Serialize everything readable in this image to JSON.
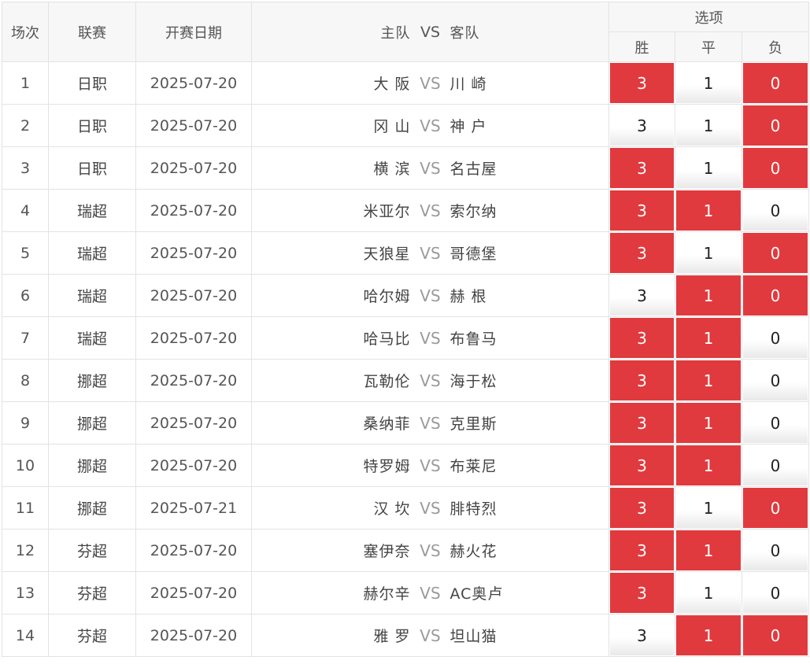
{
  "header": {
    "col_index": "场次",
    "col_league": "联赛",
    "col_date": "开赛日期",
    "col_home": "主队",
    "col_vs": "VS",
    "col_away": "客队",
    "col_options": "选项",
    "opt_win": "胜",
    "opt_draw": "平",
    "opt_loss": "负"
  },
  "colors": {
    "selected": "#e03a3e",
    "unselected": "#ffffff"
  },
  "rows": [
    {
      "index": "1",
      "league": "日职",
      "date": "2025-07-20",
      "home": "大 阪",
      "vs": "VS",
      "away": "川 崎",
      "w": "3",
      "d": "1",
      "l": "0",
      "w_on": true,
      "d_on": false,
      "l_on": true
    },
    {
      "index": "2",
      "league": "日职",
      "date": "2025-07-20",
      "home": "冈 山",
      "vs": "VS",
      "away": "神 户",
      "w": "3",
      "d": "1",
      "l": "0",
      "w_on": false,
      "d_on": false,
      "l_on": true
    },
    {
      "index": "3",
      "league": "日职",
      "date": "2025-07-20",
      "home": "横 滨",
      "vs": "VS",
      "away": "名古屋",
      "w": "3",
      "d": "1",
      "l": "0",
      "w_on": true,
      "d_on": false,
      "l_on": true
    },
    {
      "index": "4",
      "league": "瑞超",
      "date": "2025-07-20",
      "home": "米亚尔",
      "vs": "VS",
      "away": "索尔纳",
      "w": "3",
      "d": "1",
      "l": "0",
      "w_on": true,
      "d_on": true,
      "l_on": false
    },
    {
      "index": "5",
      "league": "瑞超",
      "date": "2025-07-20",
      "home": "天狼星",
      "vs": "VS",
      "away": "哥德堡",
      "w": "3",
      "d": "1",
      "l": "0",
      "w_on": true,
      "d_on": false,
      "l_on": true
    },
    {
      "index": "6",
      "league": "瑞超",
      "date": "2025-07-20",
      "home": "哈尔姆",
      "vs": "VS",
      "away": "赫 根",
      "w": "3",
      "d": "1",
      "l": "0",
      "w_on": false,
      "d_on": true,
      "l_on": true
    },
    {
      "index": "7",
      "league": "瑞超",
      "date": "2025-07-20",
      "home": "哈马比",
      "vs": "VS",
      "away": "布鲁马",
      "w": "3",
      "d": "1",
      "l": "0",
      "w_on": true,
      "d_on": true,
      "l_on": false
    },
    {
      "index": "8",
      "league": "挪超",
      "date": "2025-07-20",
      "home": "瓦勒伦",
      "vs": "VS",
      "away": "海于松",
      "w": "3",
      "d": "1",
      "l": "0",
      "w_on": true,
      "d_on": true,
      "l_on": false
    },
    {
      "index": "9",
      "league": "挪超",
      "date": "2025-07-20",
      "home": "桑纳菲",
      "vs": "VS",
      "away": "克里斯",
      "w": "3",
      "d": "1",
      "l": "0",
      "w_on": true,
      "d_on": true,
      "l_on": false
    },
    {
      "index": "10",
      "league": "挪超",
      "date": "2025-07-20",
      "home": "特罗姆",
      "vs": "VS",
      "away": "布莱尼",
      "w": "3",
      "d": "1",
      "l": "0",
      "w_on": true,
      "d_on": true,
      "l_on": false
    },
    {
      "index": "11",
      "league": "挪超",
      "date": "2025-07-21",
      "home": "汉 坎",
      "vs": "VS",
      "away": "腓特烈",
      "w": "3",
      "d": "1",
      "l": "0",
      "w_on": true,
      "d_on": false,
      "l_on": true
    },
    {
      "index": "12",
      "league": "芬超",
      "date": "2025-07-20",
      "home": "塞伊奈",
      "vs": "VS",
      "away": "赫火花",
      "w": "3",
      "d": "1",
      "l": "0",
      "w_on": true,
      "d_on": true,
      "l_on": false
    },
    {
      "index": "13",
      "league": "芬超",
      "date": "2025-07-20",
      "home": "赫尔辛",
      "vs": "VS",
      "away": "AC奥卢",
      "w": "3",
      "d": "1",
      "l": "0",
      "w_on": true,
      "d_on": false,
      "l_on": false
    },
    {
      "index": "14",
      "league": "芬超",
      "date": "2025-07-20",
      "home": "雅 罗",
      "vs": "VS",
      "away": "坦山猫",
      "w": "3",
      "d": "1",
      "l": "0",
      "w_on": false,
      "d_on": true,
      "l_on": true
    }
  ]
}
